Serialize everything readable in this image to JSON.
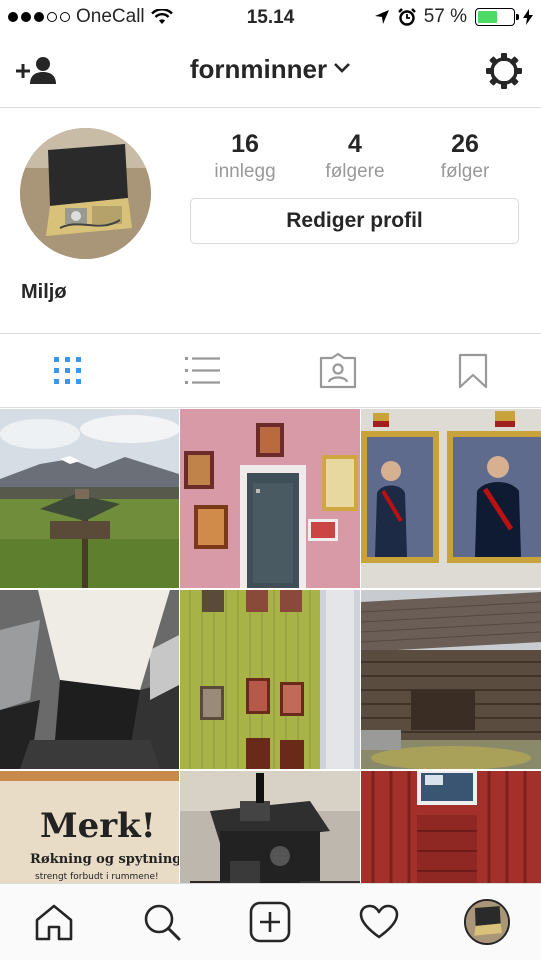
{
  "status_bar": {
    "carrier": "OneCall",
    "time": "15.14",
    "battery_percent": "57 %",
    "battery_level": 0.57,
    "battery_color": "#4cd964"
  },
  "header": {
    "username": "fornminner",
    "left_icon": "add-user-icon",
    "right_icon": "gear-icon"
  },
  "profile": {
    "stats": [
      {
        "value": "16",
        "label": "innlegg"
      },
      {
        "value": "4",
        "label": "følgere"
      },
      {
        "value": "26",
        "label": "følger"
      }
    ],
    "edit_button": "Rediger profil",
    "name": "Miljø"
  },
  "view_tabs": [
    {
      "icon": "grid-icon",
      "active": true,
      "active_color": "#3897f0"
    },
    {
      "icon": "list-icon",
      "active": false
    },
    {
      "icon": "tagged-photos-icon",
      "active": false
    },
    {
      "icon": "bookmark-icon",
      "active": false
    }
  ],
  "grid_texts": {
    "sign_title": "Merk!",
    "sign_line1": "Røkning og spytning",
    "sign_line2": "strengt forbudt i rummene!"
  },
  "bottom_tabs": [
    "home-icon",
    "search-icon",
    "new-post-icon",
    "activity-heart-icon",
    "profile-avatar"
  ]
}
